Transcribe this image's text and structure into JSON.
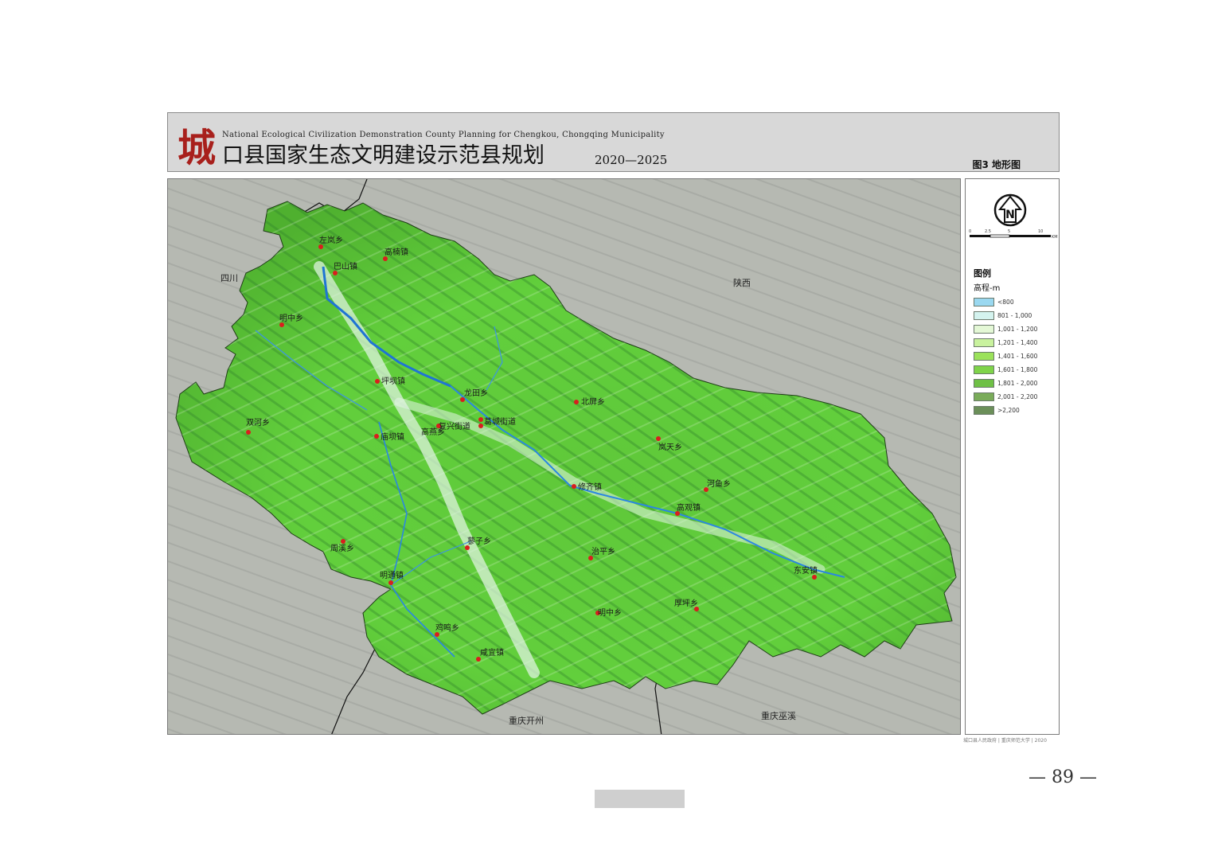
{
  "header": {
    "logo_char": "城",
    "title_en": "National Ecological Civilization Demonstration County Planning for Chengkou, Chongqing Municipality",
    "title_cn": "口县国家生态文明建设示范县规划",
    "years": "2020—2025",
    "figure_label": "图3  地形图"
  },
  "map": {
    "regions": [
      {
        "id": "sichuan",
        "name": "四川"
      },
      {
        "id": "shaanxi",
        "name": "陕西"
      },
      {
        "id": "kaizhou",
        "name": "重庆开州"
      },
      {
        "id": "wuxi",
        "name": "重庆巫溪"
      }
    ],
    "places": [
      {
        "id": "zuolan",
        "name": "左岚乡"
      },
      {
        "id": "bashan",
        "name": "巴山镇"
      },
      {
        "id": "gaoguan",
        "name": "高楠镇"
      },
      {
        "id": "mingzhong",
        "name": "明中乡"
      },
      {
        "id": "piba",
        "name": "坪坝镇"
      },
      {
        "id": "longtian",
        "name": "龙田乡"
      },
      {
        "id": "beiping",
        "name": "北屏乡"
      },
      {
        "id": "shuanghe",
        "name": "双河乡"
      },
      {
        "id": "gaoyan",
        "name": "高燕乡"
      },
      {
        "id": "fuxing",
        "name": "复兴街道"
      },
      {
        "id": "gecheng",
        "name": "葛城街道"
      },
      {
        "id": "miaoba",
        "name": "庙坝镇"
      },
      {
        "id": "lantian",
        "name": "岚天乡"
      },
      {
        "id": "hongye",
        "name": "河鱼乡"
      },
      {
        "id": "xiuqi",
        "name": "修齐镇"
      },
      {
        "id": "gaoguan2",
        "name": "高观镇"
      },
      {
        "id": "zhouxi",
        "name": "周溪乡"
      },
      {
        "id": "lizi",
        "name": "蓼子乡"
      },
      {
        "id": "zhiping",
        "name": "治平乡"
      },
      {
        "id": "dongan",
        "name": "东安镇"
      },
      {
        "id": "mingtong",
        "name": "明通镇"
      },
      {
        "id": "houping",
        "name": "厚坪乡"
      },
      {
        "id": "mingzhong2",
        "name": "明中乡"
      },
      {
        "id": "jiming",
        "name": "鸡鸣乡"
      },
      {
        "id": "xianyi",
        "name": "咸宜镇"
      }
    ]
  },
  "legend": {
    "north_letter": "N",
    "scale_ticks": [
      "0",
      "2.5",
      "5",
      "10"
    ],
    "scale_unit": "KM",
    "title": "图例",
    "subtitle": "高程-m",
    "items": [
      {
        "label": "<800",
        "color": "#9ad8f0"
      },
      {
        "label": "801 - 1,000",
        "color": "#d4f3ef"
      },
      {
        "label": "1,001 - 1,200",
        "color": "#e4f8d6"
      },
      {
        "label": "1,201 - 1,400",
        "color": "#c9f29e"
      },
      {
        "label": "1,401 - 1,600",
        "color": "#9be25a"
      },
      {
        "label": "1,601 - 1,800",
        "color": "#7fd44a"
      },
      {
        "label": "1,801 - 2,000",
        "color": "#6fc046"
      },
      {
        "label": "2,001 - 2,200",
        "color": "#7aac5a"
      },
      {
        "label": ">2,200",
        "color": "#6b8f59"
      }
    ],
    "credit": "城口县人民政府 | 重庆师范大学 | 2020"
  },
  "page": {
    "number": "— 89 —"
  }
}
